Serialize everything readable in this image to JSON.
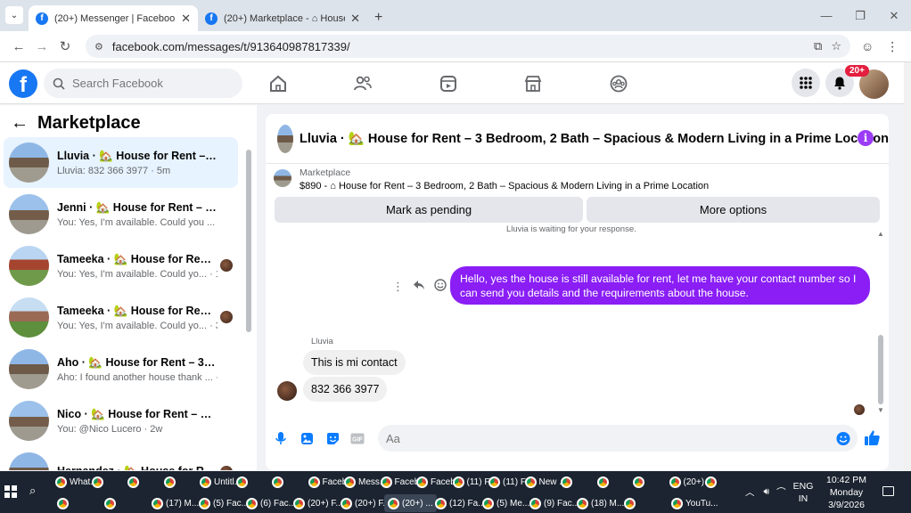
{
  "browser": {
    "tabs": [
      {
        "title": "(20+) Messenger | Facebook",
        "close": "✕",
        "active": true
      },
      {
        "title": "(20+) Marketplace - ⌂ House",
        "close": "✕",
        "active": false
      }
    ],
    "new_tab": "+",
    "url": "facebook.com/messages/t/913640987817339/"
  },
  "header": {
    "logo": "f",
    "search_placeholder": "Search Facebook",
    "notification_count": "20+"
  },
  "left_panel": {
    "title": "Marketplace",
    "conversations": [
      {
        "name": "Lluvia · 🏡 House for Rent – 3 B...",
        "preview": "Lluvia: 832 366 3977 · 5m",
        "active": true,
        "seen": false
      },
      {
        "name": "Jenni · 🏡 House for Rent – 3 Be...",
        "preview": "You: Yes, I'm available. Could you ... · 30m",
        "active": false,
        "seen": false
      },
      {
        "name": "Tameeka · 🏡 House for Rent ...",
        "preview": "You: Yes, I'm available. Could yo... · 1d",
        "active": false,
        "seen": true
      },
      {
        "name": "Tameeka · 🏡 House for Rent ...",
        "preview": "You: Yes, I'm available. Could yo... · 3d",
        "active": false,
        "seen": true
      },
      {
        "name": "Aho · 🏡 House for Rent – 3 Bed...",
        "preview": "Aho: I found another house thank ... · 1w",
        "active": false,
        "seen": false
      },
      {
        "name": "Nico · 🏡 House for Rent – 3 Be...",
        "preview": "You: @Nico Lucero · 2w",
        "active": false,
        "seen": false
      },
      {
        "name": "Hernandez · 🏡 House for Re...",
        "preview": "",
        "active": false,
        "seen": true
      }
    ]
  },
  "chat": {
    "title": "Lluvia · 🏡 House for Rent – 3 Bedroom, 2 Bath – Spacious & Modern Living in a Prime Location",
    "info": "i",
    "listing": {
      "label": "Marketplace",
      "line": "$890 - ⌂ House for Rent – 3 Bedroom, 2 Bath – Spacious & Modern Living in a Prime Location"
    },
    "buttons": {
      "pending": "Mark as pending",
      "more": "More options"
    },
    "waiting_note": "Lluvia is waiting for your response.",
    "outgoing": "Hello, yes the house is still available for rent, let me have your contact number so I can send you details and the requirements about the house.",
    "sender_name": "Lluvia",
    "incoming": [
      "This is mi contact",
      "832 366 3977"
    ],
    "composer_placeholder": "Aa",
    "colors": {
      "outgoing_bubble": "#8a1ef5",
      "accent": "#0a7cff"
    }
  },
  "taskbar": {
    "row1": [
      "What...",
      "",
      "",
      "",
      "Untitl...",
      "",
      "",
      "Faceb...",
      "Mess...",
      "Faceb...",
      "Faceb...",
      "(11) F...",
      "(11) F...",
      "New ...",
      "",
      "",
      "",
      "(20+)...",
      ""
    ],
    "row2": [
      "",
      "",
      "(17) M...",
      "(5) Fac...",
      "(6) Fac...",
      "(20+) F...",
      "(20+) F...",
      "(20+) ...",
      "(12) Fa...",
      "(5) Me...",
      "(9) Fac...",
      "(18) M...",
      "",
      "YouTu..."
    ],
    "lang_top": "ENG",
    "lang_bottom": "IN",
    "time": "10:42 PM",
    "day": "Monday",
    "date": "3/9/2026"
  }
}
